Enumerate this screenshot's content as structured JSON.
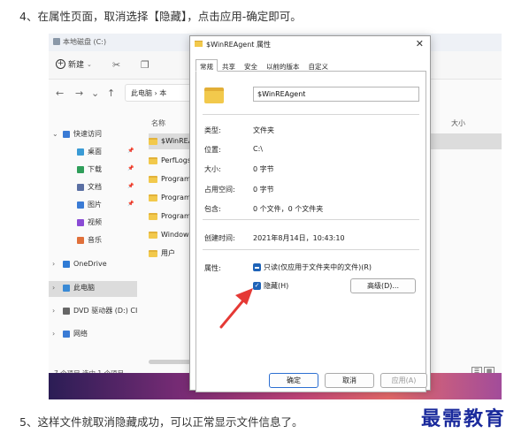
{
  "captions": {
    "top": "4、在属性页面，取消选择【隐藏】，点击应用-确定即可。",
    "bottom": "5、这样文件就取消隐藏成功，可以正常显示文件信息了。"
  },
  "watermark": "最需教育",
  "explorer": {
    "title": "本地磁盘 (C:)",
    "new_label": "新建",
    "address": "此电脑 › 本",
    "column_name": "名称",
    "column_size": "大小",
    "sidebar": [
      {
        "label": "快速访问",
        "icon": "star-icon"
      },
      {
        "label": "桌面",
        "icon": "desktop-icon"
      },
      {
        "label": "下载",
        "icon": "download-icon"
      },
      {
        "label": "文档",
        "icon": "document-icon"
      },
      {
        "label": "图片",
        "icon": "picture-icon"
      },
      {
        "label": "视频",
        "icon": "video-icon"
      },
      {
        "label": "音乐",
        "icon": "music-icon"
      },
      {
        "label": "OneDrive",
        "icon": "cloud-icon"
      },
      {
        "label": "此电脑",
        "icon": "computer-icon"
      },
      {
        "label": "DVD 驱动器 (D:) CI",
        "icon": "dvd-icon"
      },
      {
        "label": "网络",
        "icon": "network-icon"
      }
    ],
    "files": [
      "$WinREA",
      "PerfLogs",
      "Program",
      "Program",
      "Program",
      "Windows",
      "用户"
    ],
    "status": "7 个项目    选中 1 个项目"
  },
  "dialog": {
    "title": "$WinREAgent 属性",
    "tabs": [
      "常规",
      "共享",
      "安全",
      "以前的版本",
      "自定义"
    ],
    "name": "$WinREAgent",
    "props": [
      {
        "label": "类型:",
        "value": "文件夹"
      },
      {
        "label": "位置:",
        "value": "C:\\"
      },
      {
        "label": "大小:",
        "value": "0 字节"
      },
      {
        "label": "占用空间:",
        "value": "0 字节"
      },
      {
        "label": "包含:",
        "value": "0 个文件，0 个文件夹"
      }
    ],
    "created_label": "创建时间:",
    "created_value": "2021年8月14日，10:43:10",
    "attributes_label": "属性:",
    "readonly_label": "只读(仅应用于文件夹中的文件)(R)",
    "hidden_label": "隐藏(H)",
    "advanced_button": "高级(D)...",
    "ok_button": "确定",
    "cancel_button": "取消",
    "apply_button": "应用(A)",
    "accent_color": "#1e63b8",
    "arrow_color": "#e53935"
  }
}
